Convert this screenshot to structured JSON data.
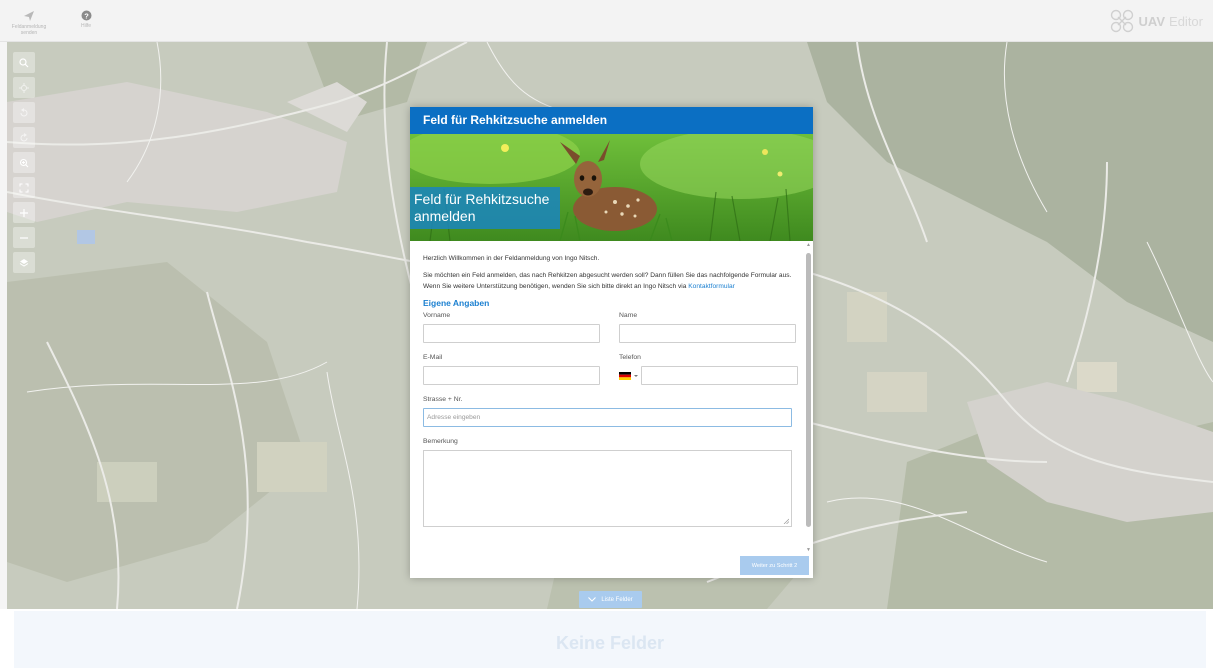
{
  "toolbar": {
    "send_label": "Feldanmeldung senden",
    "help_label": "Hilfe",
    "logo_uav": "UAV",
    "logo_editor": "Editor"
  },
  "dialog": {
    "header_title": "Feld für Rehkitzsuche anmelden",
    "hero_title": "Feld für Rehkitzsuche anmelden",
    "welcome": "Herzlich Willkommen in der Feldanmeldung von Ingo Nitsch.",
    "intro": "Sie möchten ein Feld anmelden, das nach Rehkitzen abgesucht werden soll? Dann füllen Sie das nachfolgende Formular aus. Wenn Sie weitere Unterstützung benötigen, wenden Sie sich bitte direkt an Ingo Nitsch via",
    "contact_link": "Kontaktformular",
    "section_title": "Eigene Angaben",
    "fields": {
      "vorname_label": "Vorname",
      "vorname_value": "",
      "name_label": "Name",
      "name_value": "",
      "email_label": "E-Mail",
      "email_value": "",
      "telefon_label": "Telefon",
      "telefon_value": "",
      "strasse_label": "Strasse + Nr.",
      "strasse_placeholder": "Adresse eingeben",
      "bemerkung_label": "Bemerkung",
      "bemerkung_value": ""
    },
    "next_button": "Weiter zu Schritt 2"
  },
  "list_toggle_label": "Liste Felder",
  "bottom_panel_title": "Keine Felder",
  "colors": {
    "header_blue": "#0b6fc3",
    "link_blue": "#1a7fd0",
    "button_light_blue": "#a9cbee"
  },
  "icons": {
    "send": "send-icon",
    "help": "help-icon",
    "logo": "drone-logo-icon",
    "chevron": "chevron-down-icon",
    "flag": "germany-flag-icon"
  }
}
